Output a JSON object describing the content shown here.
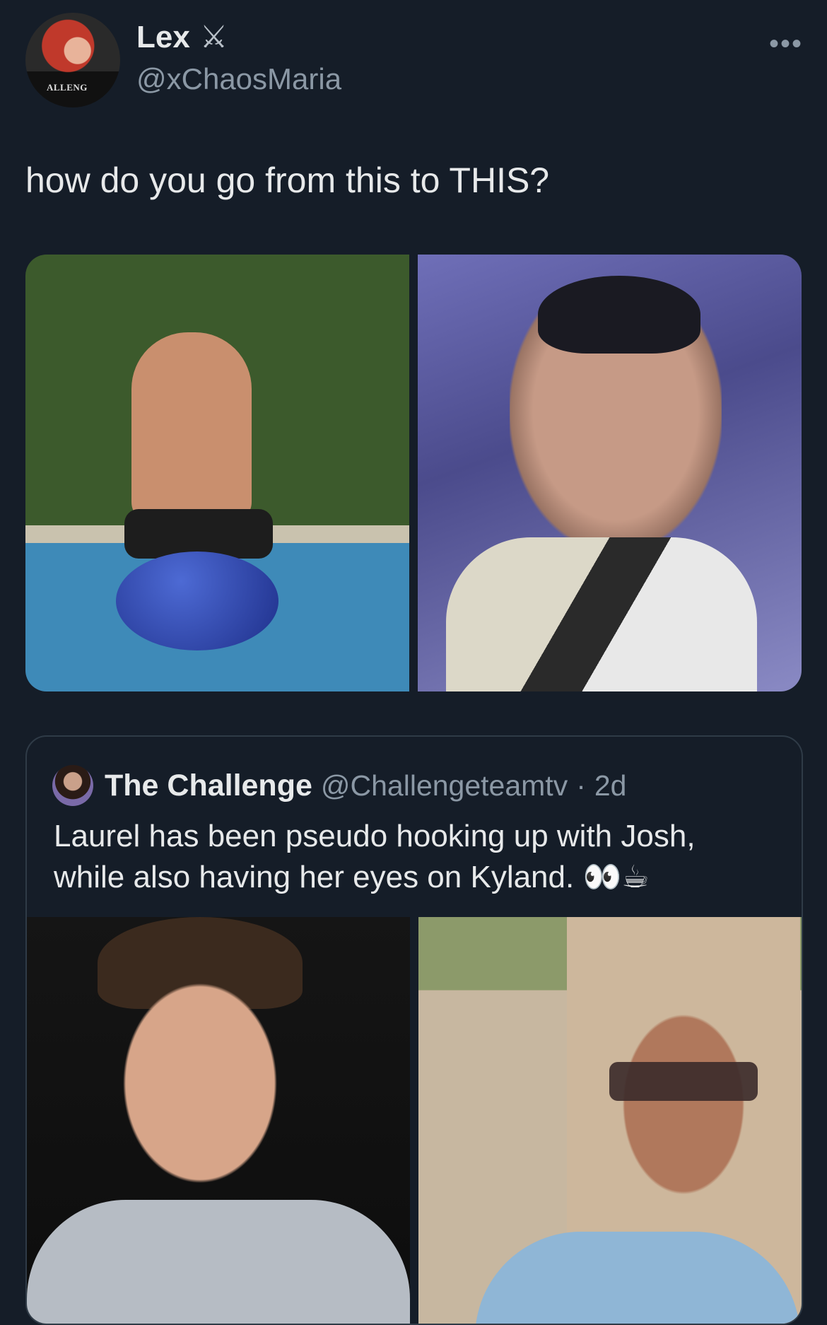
{
  "tweet": {
    "display_name": "Lex",
    "name_emoji": "⚔",
    "handle": "@xChaosMaria",
    "more": "•••",
    "avatar_shirt_text": "ALLENG",
    "text": "how do you go from this to THIS?"
  },
  "quoted_tweet": {
    "display_name": "The Challenge",
    "handle": "@Challengeteamtv",
    "separator": "·",
    "time": "2d",
    "text": "Laurel has been pseudo hooking up with Josh, while also having her eyes on Kyland. 👀☕"
  },
  "colors": {
    "background": "#151d28",
    "text_primary": "#e7e9ea",
    "text_secondary": "#8b98a5",
    "border": "#2f3b47"
  }
}
